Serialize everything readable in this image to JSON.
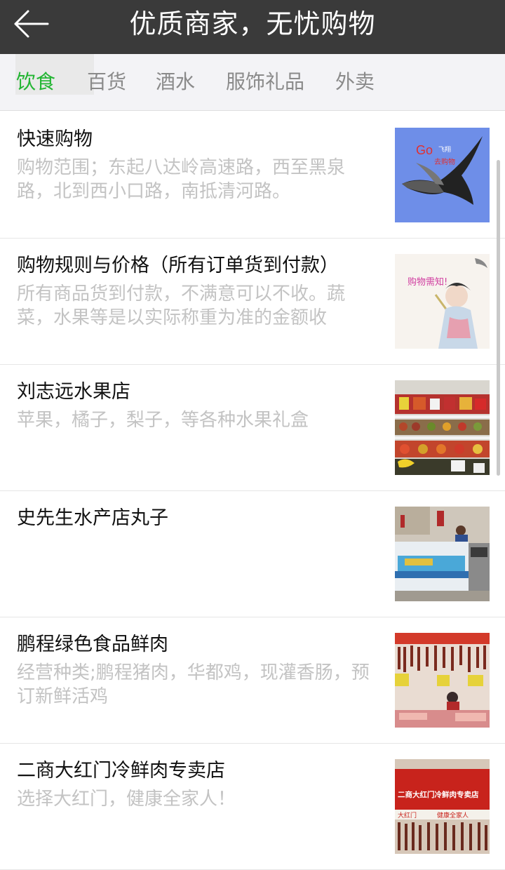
{
  "header": {
    "title": "优质商家，无忧购物",
    "back_icon": "arrow-left-icon"
  },
  "tabs": [
    {
      "label": "饮食",
      "active": true
    },
    {
      "label": "百货",
      "active": false
    },
    {
      "label": "酒水",
      "active": false
    },
    {
      "label": "服饰礼品",
      "active": false
    },
    {
      "label": "外卖",
      "active": false
    }
  ],
  "colors": {
    "header_bg": "#3a3a3a",
    "active_tab": "#22b532",
    "inactive_tab": "#8a8a8a",
    "desc_text": "#c3c3c3"
  },
  "shops": [
    {
      "title": "快速购物",
      "desc": "购物范围；东起八达岭高速路，西至黑泉路，北到西小口路，南抵清河路。",
      "thumb_text_1": "Go",
      "thumb_text_2": "飞翔",
      "thumb_text_3": "去购物"
    },
    {
      "title": "购物规则与价格（所有订单货到付款）",
      "desc": "所有商品货到付款，不满意可以不收。蔬菜，水果等是以实际称重为准的金额收",
      "thumb_text_1": "购物需知!"
    },
    {
      "title": "刘志远水果店",
      "desc": "苹果，橘子，梨子，等各种水果礼盒"
    },
    {
      "title": "史先生水产店丸子",
      "desc": ""
    },
    {
      "title": "鹏程绿色食品鲜肉",
      "desc": "经营种类;鹏程猪肉，华都鸡，现灌香肠，预订新鲜活鸡"
    },
    {
      "title": "二商大红门冷鲜肉专卖店",
      "desc": "选择大红门，健康全家人！",
      "thumb_text_1": "二商大红门冷鲜肉专卖店",
      "thumb_text_2": "大红门",
      "thumb_text_3": "健康全家人"
    }
  ]
}
